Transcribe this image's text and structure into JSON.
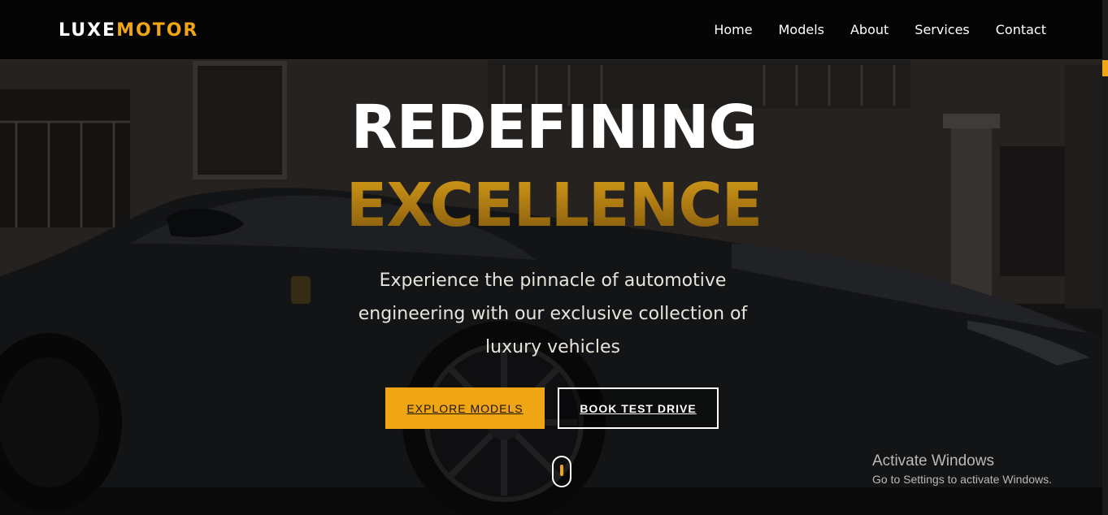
{
  "brand": {
    "part1": "LUXE",
    "part2": "MOTOR"
  },
  "nav": {
    "items": [
      "Home",
      "Models",
      "About",
      "Services",
      "Contact"
    ]
  },
  "hero": {
    "title_line1": "REDEFINING",
    "title_line2": "EXCELLENCE",
    "subtitle": "Experience the pinnacle of automotive engineering with our exclusive collection of luxury vehicles",
    "primary_button": "EXPLORE MODELS",
    "secondary_button": "BOOK TEST DRIVE"
  },
  "windows_watermark": {
    "title": "Activate Windows",
    "subtitle": "Go to Settings to activate Windows."
  },
  "colors": {
    "accent": "#f0a514",
    "nav_bg": "#050505",
    "text": "#ffffff"
  }
}
